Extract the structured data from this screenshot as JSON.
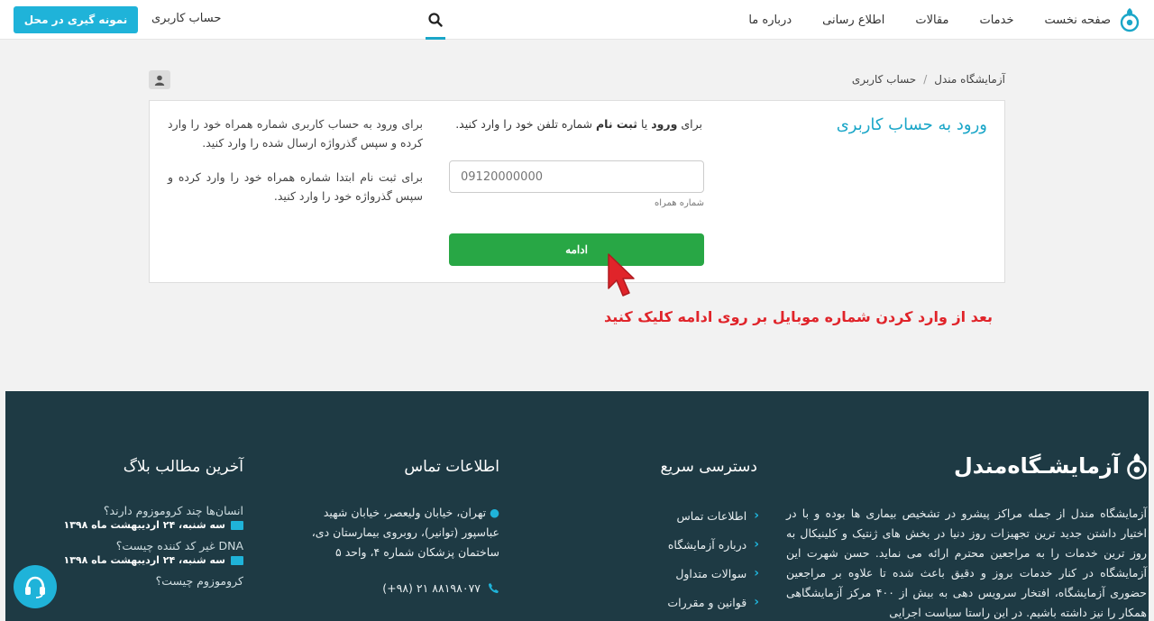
{
  "nav": {
    "menu": [
      "صفحه نخست",
      "خدمات",
      "مقالات",
      "اطلاع رسانی",
      "درباره ما"
    ],
    "account_link": "حساب کاربری",
    "sample_button": "نمونه گیری در محل",
    "accent_color": "#1fb3d9"
  },
  "breadcrumb": {
    "home": "آزمایشگاه مندل",
    "current": "حساب کاربری"
  },
  "login": {
    "title": "ورود به حساب کاربری",
    "instruction_prefix": "برای",
    "instruction_login": "ورود",
    "instruction_or": "یا",
    "instruction_register": "ثبت نام",
    "instruction_suffix": "شماره تلفن خود را وارد کنید.",
    "phone_placeholder": "09120000000",
    "phone_label": "شماره همراه",
    "continue_button": "ادامه",
    "help_login": "برای ورود به حساب کاربری شماره همراه خود را وارد کرده و سپس گذرواژه ارسال شده را وارد کنید.",
    "help_register": "برای ثبت نام ابتدا شماره همراه خود را وارد کرده و سپس گذرواژه خود را وارد کنید."
  },
  "annotation": "بعد از وارد کردن شماره موبایل بر روی ادامه کلیک کنید",
  "footer": {
    "logo_text": "آزمایشـگاه‌مندل",
    "about": "آزمایشگاه مندل از جمله مراکز پیشرو در تشخیص بیماری ها بوده و با در اختیار داشتن جدید ترین تجهیزات روز دنیا در بخش های ژنتیک و کلینیکال به روز ترین خدمات را به مراجعین محترم ارائه می نماید. حسن شهرت این آزمایشگاه در کنار خدمات بروز و دقیق باعث شده تا علاوه بر مراجعین حضوری آزمایشگاه، افتخار سرویس دهی به بیش از ۴۰۰ مرکز آزمایشگاهی همکار را نیز داشته باشیم. در این راستا سیاست اجرایی",
    "quick_title": "دسترسی سریع",
    "quick_links": [
      "اطلاعات تماس",
      "درباره آزمایشگاه",
      "سوالات متداول",
      "قوانین و مقررات"
    ],
    "contact_title": "اطلاعات تماس",
    "address": "تهران، خیابان ولیعصر، خیابان شهید عباسپور (توانیر)، روبروی بیمارستان دی، ساختمان پزشکان شماره ۴، واحد ۵",
    "phone": "(+۹۸) ۲۱ ۸۸۱۹۸۰۷۷",
    "blog_title": "آخرین مطالب بلاگ",
    "blog_posts": [
      {
        "title": "انسان‌ها چند کروموزوم دارند؟",
        "date": "سه شنبه، ۲۴ اردیبهشت ماه ۱۳۹۸"
      },
      {
        "title": "DNA غیر کد کننده چیست؟",
        "date": "سه شنبه، ۲۴ اردیبهشت ماه ۱۳۹۸"
      },
      {
        "title": "کروموزوم چیست؟",
        "date": ""
      }
    ],
    "background_color": "#1e3a44"
  }
}
